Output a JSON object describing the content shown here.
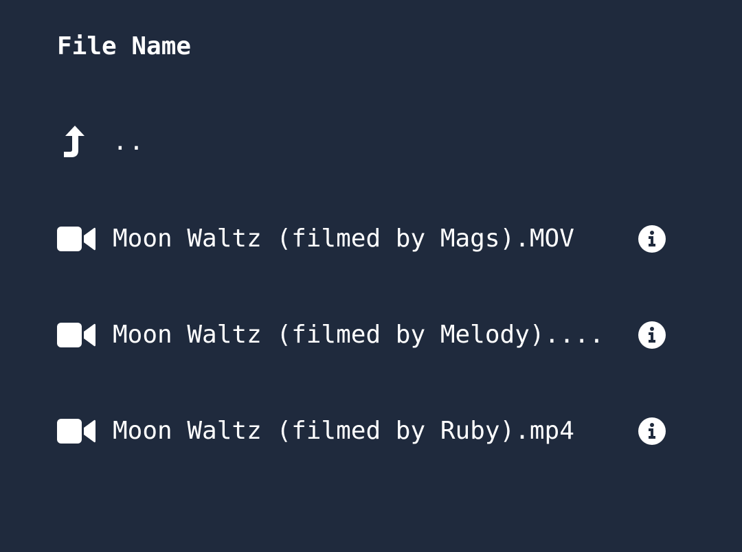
{
  "header": {
    "title": "File Name"
  },
  "parent_entry": {
    "icon": "level-up-icon",
    "label": ".."
  },
  "files": [
    {
      "icon": "video-camera-icon",
      "name": "Moon Waltz (filmed by Mags).MOV",
      "action_icon": "info-icon"
    },
    {
      "icon": "video-camera-icon",
      "name": "Moon Waltz (filmed by Melody)....",
      "action_icon": "info-icon"
    },
    {
      "icon": "video-camera-icon",
      "name": "Moon Waltz (filmed by Ruby).mp4",
      "action_icon": "info-icon"
    }
  ],
  "colors": {
    "background": "#1f2a3d",
    "foreground": "#ffffff"
  }
}
